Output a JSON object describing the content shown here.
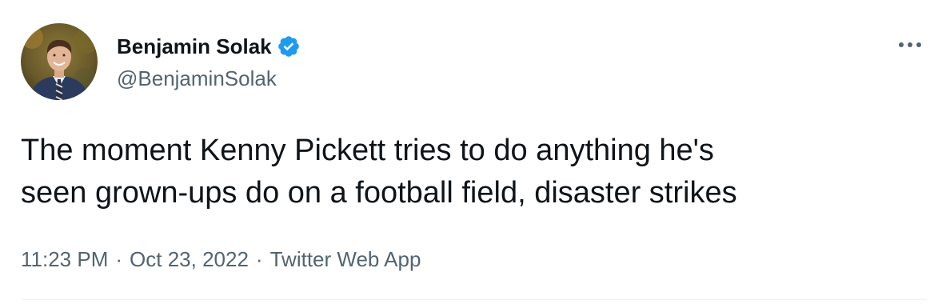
{
  "author": {
    "display_name": "Benjamin Solak",
    "handle": "@BenjaminSolak",
    "verified_icon": "verified-badge-icon",
    "avatar_icon": "profile-photo"
  },
  "tweet": {
    "text": "The moment Kenny Pickett tries to do anything he's\nseen grown-ups do on a football field, disaster strikes",
    "time": "11:23 PM",
    "date": "Oct 23, 2022",
    "source": "Twitter Web App",
    "separator": "·"
  },
  "menu": {
    "more_icon": "more-options-icon"
  },
  "colors": {
    "text_primary": "#0f1419",
    "text_secondary": "#536471",
    "verified_blue": "#1d9bf0",
    "divider": "#eff3f4"
  }
}
